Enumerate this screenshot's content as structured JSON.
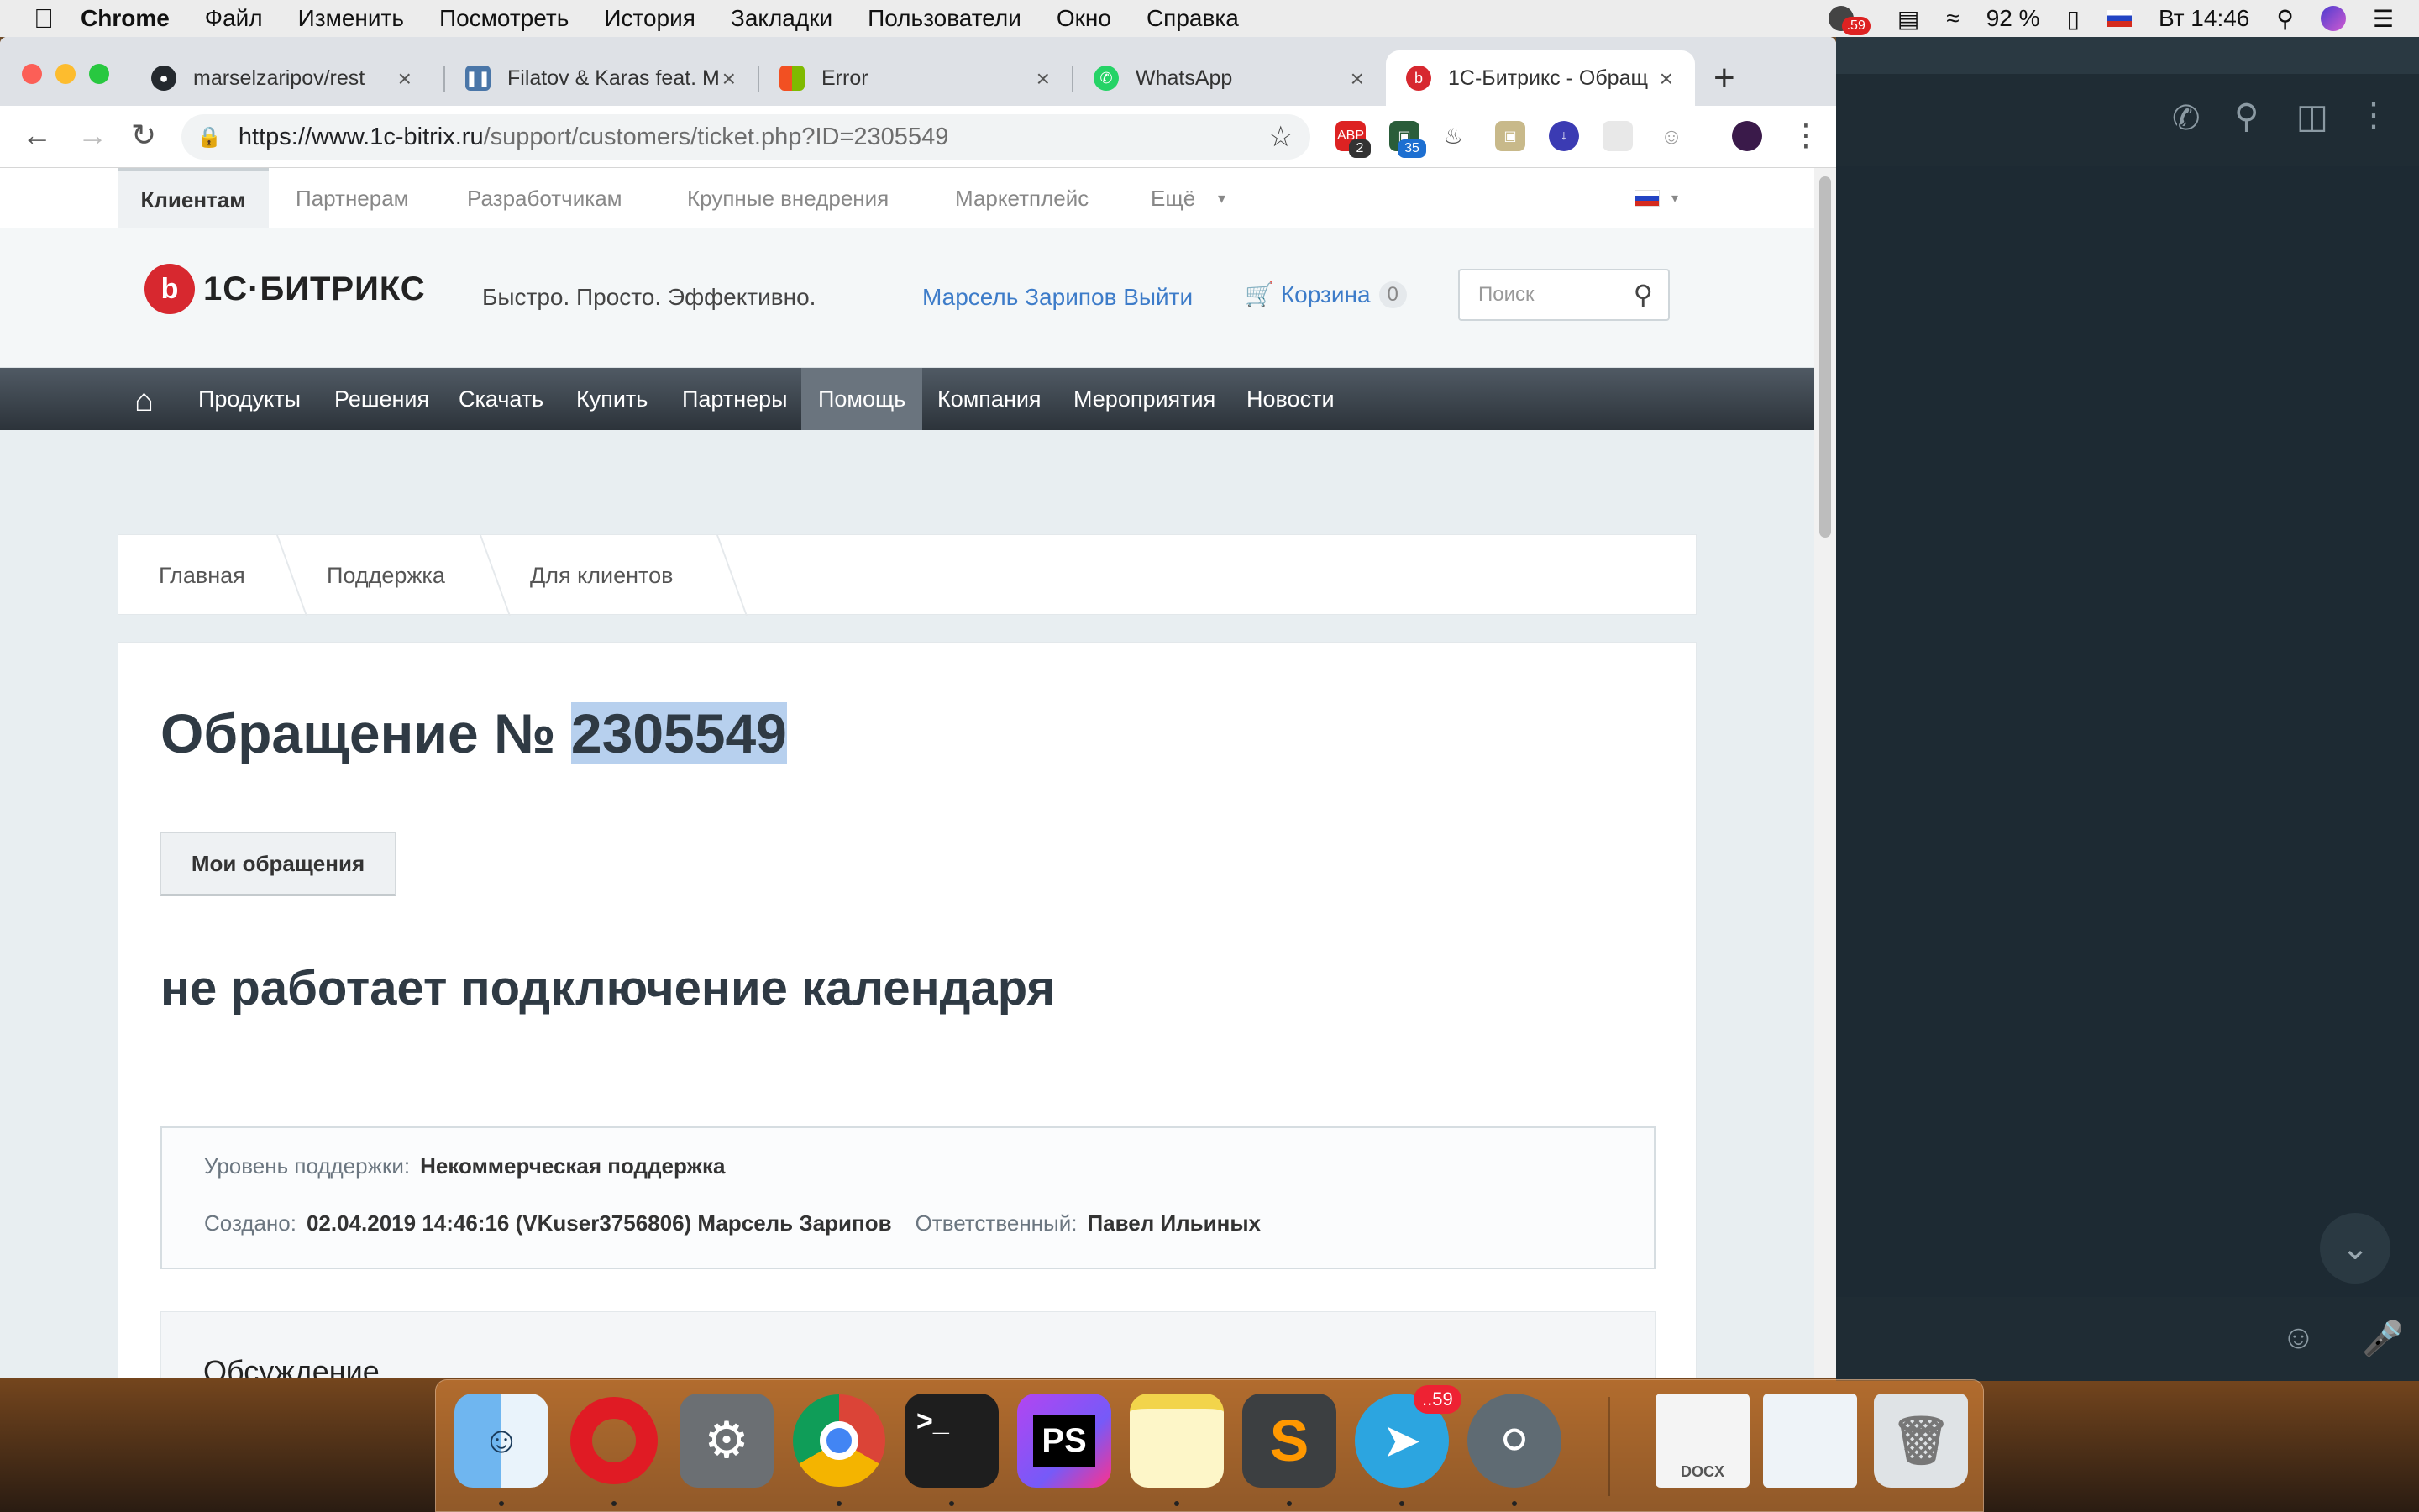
{
  "menubar": {
    "app": "Chrome",
    "items": [
      "Файл",
      "Изменить",
      "Посмотреть",
      "История",
      "Закладки",
      "Пользователи",
      "Окно",
      "Справка"
    ],
    "badge": ".59",
    "battery": "92 %",
    "clock": "Вт 14:46"
  },
  "tabs": [
    {
      "title": "marselzaripov/rest"
    },
    {
      "title": "Filatov & Karas feat. M"
    },
    {
      "title": "Error"
    },
    {
      "title": "WhatsApp"
    },
    {
      "title": "1С-Битрикс - Обращ"
    }
  ],
  "omnibox": {
    "host": "https://www.1c-bitrix.ru",
    "path": "/support/customers/ticket.php?ID=2305549"
  },
  "extensions": {
    "abp_count": "2",
    "ext2_count": "35"
  },
  "topnav": [
    "Клиентам",
    "Партнерам",
    "Разработчикам",
    "Крупные внедрения",
    "Маркетплейс",
    "Ещё"
  ],
  "header": {
    "logo": "1С·БИТРИКС",
    "slogan": "Быстро. Просто. Эффективно.",
    "user": "Марсель Зарипов Выйти",
    "cart_label": "Корзина",
    "cart_count": "0",
    "search_placeholder": "Поиск"
  },
  "mainnav": [
    "Продукты",
    "Решения",
    "Скачать",
    "Купить",
    "Партнеры",
    "Помощь",
    "Компания",
    "Мероприятия",
    "Новости"
  ],
  "breadcrumb": [
    "Главная",
    "Поддержка",
    "Для клиентов"
  ],
  "ticket": {
    "title_prefix": "Обращение №",
    "number": "2305549",
    "my_tickets_button": "Мои обращения",
    "subject": "не работает подключение календаря",
    "support_level_label": "Уровень поддержки:",
    "support_level": "Некоммерческая поддержка",
    "created_label": "Создано:",
    "created": "02.04.2019 14:46:16 (VKuser3756806) Марсель Зарипов",
    "responsible_label": "Ответственный:",
    "responsible": "Павел Ильиных",
    "discussion_title": "Обсуждение"
  },
  "dock": {
    "telegram_badge": "..59",
    "items": [
      "Finder",
      "Opera",
      "System Preferences",
      "Chrome",
      "Terminal",
      "PhpStorm",
      "Notes",
      "Sublime Text",
      "Telegram",
      "Sequel Pro",
      "DOCX",
      "Screenshot",
      "Trash"
    ]
  },
  "colors": {
    "accent_link": "#3d7cc9",
    "brand_red": "#d7282f",
    "nav_dark": "#2c333a",
    "highlight": "#b7d0ee"
  }
}
